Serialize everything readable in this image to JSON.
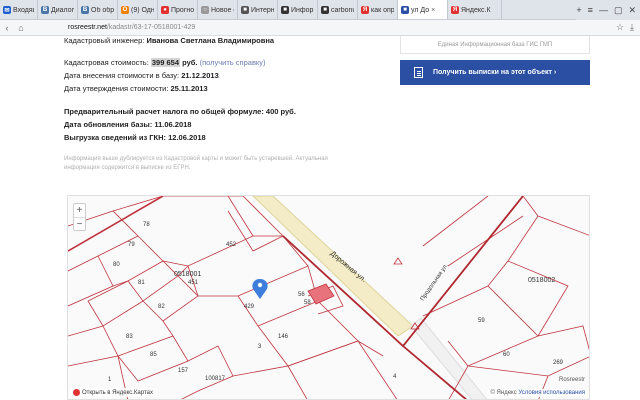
{
  "browser": {
    "tabs": [
      {
        "label": "Входящ",
        "color": "#1e5fcf",
        "glyph": "✉"
      },
      {
        "label": "Диалоги",
        "color": "#4a76a8",
        "glyph": "В"
      },
      {
        "label": "Об обре",
        "color": "#4a76a8",
        "glyph": "В"
      },
      {
        "label": "(9) Одн",
        "color": "#ee8208",
        "glyph": "О"
      },
      {
        "label": "Прогноз",
        "color": "#e03030",
        "glyph": "●"
      },
      {
        "label": "Новое со",
        "color": "#999999",
        "glyph": "○"
      },
      {
        "label": "Интерне",
        "color": "#555555",
        "glyph": "■"
      },
      {
        "label": "Информ",
        "color": "#333333",
        "glyph": "■"
      },
      {
        "label": "carbonu",
        "color": "#333333",
        "glyph": "■"
      },
      {
        "label": "как опре",
        "color": "#e03030",
        "glyph": "Я"
      },
      {
        "label": "ул До",
        "color": "#2a4fa3",
        "glyph": "■",
        "active": true
      },
      {
        "label": "Яндекс.К",
        "color": "#e03030",
        "glyph": "Я"
      }
    ],
    "new_tab": "+",
    "window_controls": [
      "≡",
      "—",
      "▢",
      "✕"
    ],
    "url_domain": "rosreestr.net",
    "url_path": "/kadastr/63-17-0518001-429"
  },
  "info": {
    "engineer_label": "Кадастровый инженер:",
    "engineer_value": "Иванова Светлана Владимировна",
    "cost_label": "Кадастровая стоимость:",
    "cost_value": "399 654",
    "cost_unit": "руб.",
    "cost_link": "(получить справку)",
    "added_label": "Дата внесения стоимости в базу:",
    "added_value": "21.12.2013",
    "approved_label": "Дата утверждения стоимости:",
    "approved_value": "25.11.2013",
    "tax_line": "Предварительный расчет налога по общей формуле: 400 руб.",
    "update_label": "Дата обновления базы:",
    "update_value": "11.06.2018",
    "gkn_label": "Выгрузка сведений из ГКН:",
    "gkn_value": "12.06.2018",
    "note_line1": "Информация выше дублируется из Кадастровой карты и может быть устаревшей. Актуальная",
    "note_line2": "информация содержится в выписке из ЕГРН."
  },
  "panel": {
    "db_text": "Единая Информационная база ГИС ГМП",
    "cta_label": "Получить выписки на этот объект ›"
  },
  "map": {
    "zoom_in": "+",
    "zoom_out": "−",
    "labels": {
      "p78": "78",
      "p79": "79",
      "p80": "80",
      "p81": "81",
      "p82": "82",
      "p83": "83",
      "p85": "85",
      "p451": "451",
      "p452": "452",
      "p429": "429",
      "p146": "146",
      "p59": "59",
      "p60": "60",
      "p269": "269",
      "p4": "4",
      "p100817": "100817",
      "p157": "157",
      "p56": "56",
      "p58": "58",
      "p1": "1",
      "p3": "3",
      "q1": "0518001",
      "q2": "0518002",
      "street1": "Дорожная ул.",
      "street2": "Продольная ул."
    },
    "footer_left": "Открыть в Яндекс.Картах",
    "source": "Rosreestr",
    "footer_right_copy": "© Яндекс",
    "footer_right_terms": "Условия использования"
  }
}
